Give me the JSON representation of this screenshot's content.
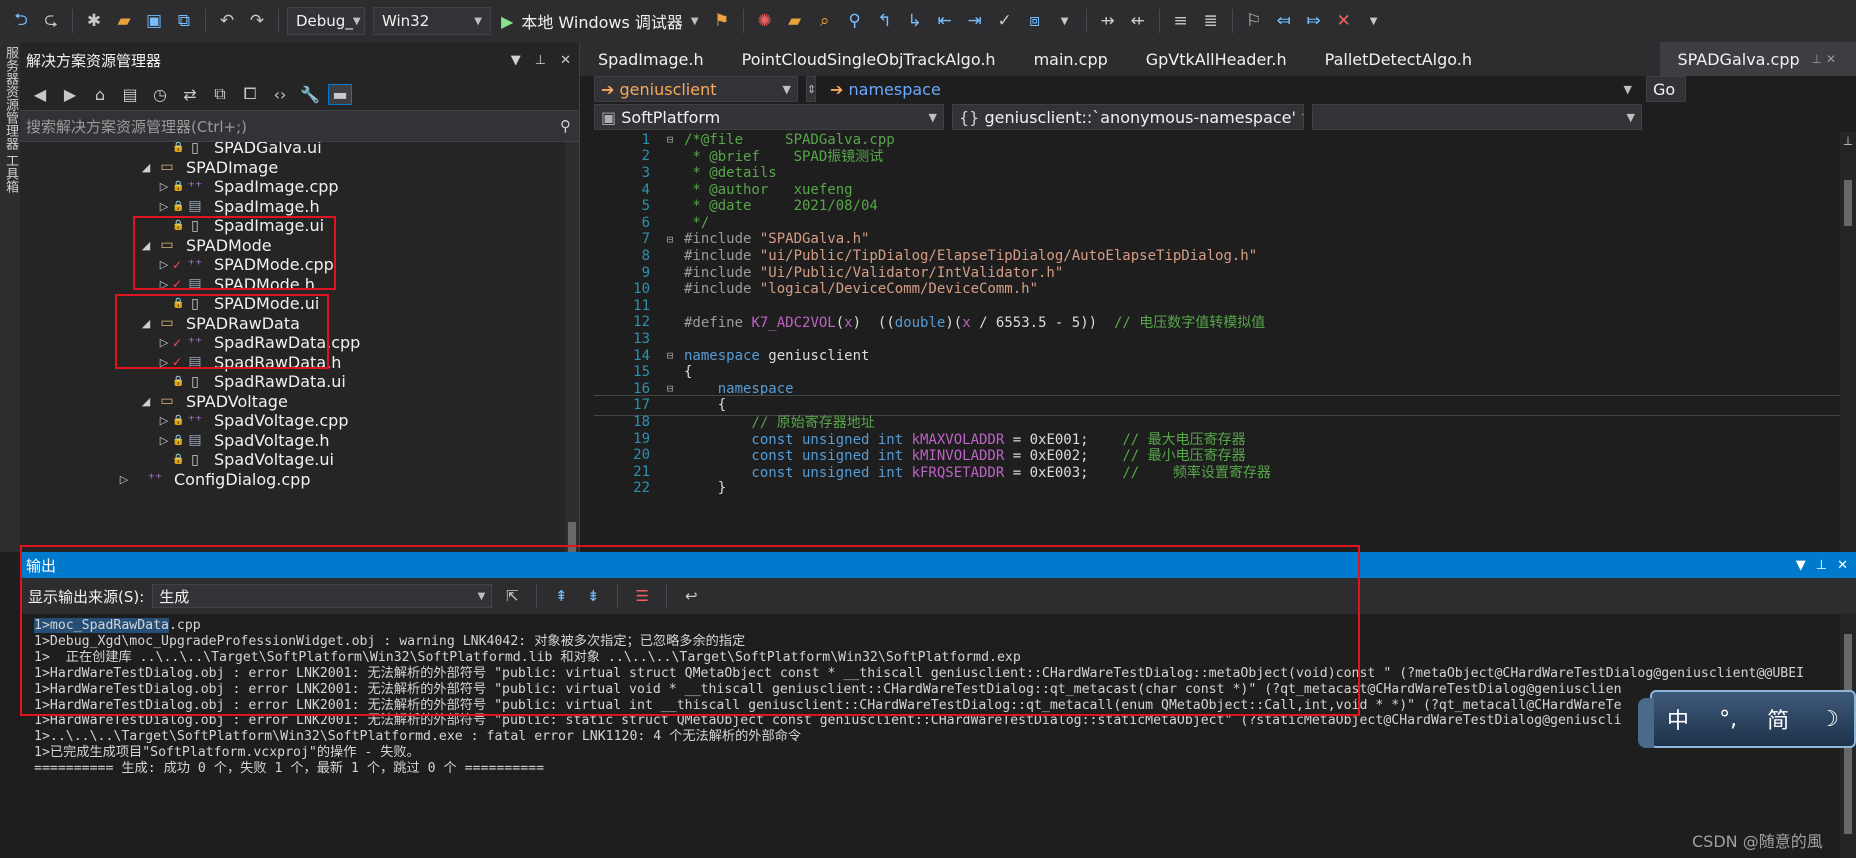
{
  "toolbar": {
    "config": "Debug_",
    "platform": "Win32",
    "run_label": "本地 Windows 调试器"
  },
  "left_strip": {
    "label": "服务器资源管理器  工具箱"
  },
  "solution": {
    "title": "解决方案资源管理器",
    "search_placeholder": "搜索解决方案资源管理器(Ctrl+;)",
    "tree": [
      {
        "text": "SPADGalva.ui",
        "kind": "ui",
        "depth": 3,
        "lock": true
      },
      {
        "text": "SPADImage",
        "kind": "folder",
        "depth": 2,
        "expanded": true
      },
      {
        "text": "SpadImage.cpp",
        "kind": "cpp",
        "depth": 3,
        "lock": true,
        "has_children": true
      },
      {
        "text": "SpadImage.h",
        "kind": "h",
        "depth": 3,
        "lock": true,
        "has_children": true
      },
      {
        "text": "SpadImage.ui",
        "kind": "ui",
        "depth": 3,
        "lock": true
      },
      {
        "text": "SPADMode",
        "kind": "folder",
        "depth": 2,
        "expanded": true
      },
      {
        "text": "SPADMode.cpp",
        "kind": "cpp",
        "depth": 3,
        "check": true,
        "has_children": true
      },
      {
        "text": "SPADMode.h",
        "kind": "h",
        "depth": 3,
        "check": true,
        "has_children": true
      },
      {
        "text": "SPADMode.ui",
        "kind": "ui",
        "depth": 3,
        "lock": true
      },
      {
        "text": "SPADRawData",
        "kind": "folder",
        "depth": 2,
        "expanded": true
      },
      {
        "text": "SpadRawData.cpp",
        "kind": "cpp",
        "depth": 3,
        "check": true,
        "has_children": true
      },
      {
        "text": "SpadRawData.h",
        "kind": "h",
        "depth": 3,
        "check": true,
        "has_children": true
      },
      {
        "text": "SpadRawData.ui",
        "kind": "ui",
        "depth": 3,
        "lock": true
      },
      {
        "text": "SPADVoltage",
        "kind": "folder",
        "depth": 2,
        "expanded": true
      },
      {
        "text": "SpadVoltage.cpp",
        "kind": "cpp",
        "depth": 3,
        "lock": true,
        "has_children": true
      },
      {
        "text": "SpadVoltage.h",
        "kind": "h",
        "depth": 3,
        "lock": true,
        "has_children": true
      },
      {
        "text": "SpadVoltage.ui",
        "kind": "ui",
        "depth": 3,
        "lock": true
      },
      {
        "text": "ConfigDialog.cpp",
        "kind": "cpp",
        "depth": 1,
        "has_children": true
      }
    ]
  },
  "editor": {
    "tabs": [
      "SpadImage.h",
      "PointCloudSingleObjTrackAlgo.h",
      "main.cpp",
      "GpVtkAllHeader.h",
      "PalletDetectAlgo.h",
      "SPADGalva.cpp"
    ],
    "active_tab": "SPADGalva.cpp",
    "nav1_left": "geniusclient",
    "nav1_mid": "namespace",
    "nav1_right": "Go",
    "nav2_left": "SoftPlatform",
    "nav2_mid": "geniusclient::`anonymous-namespace'",
    "lines": [
      {
        "n": "1",
        "fold": "⊟",
        "parts": [
          [
            "green",
            "/*@file     SPADGalva.cpp"
          ]
        ]
      },
      {
        "n": "2",
        "parts": [
          [
            "green",
            " * @brief    SPAD振镜测试"
          ]
        ]
      },
      {
        "n": "3",
        "parts": [
          [
            "green",
            " * @details"
          ]
        ]
      },
      {
        "n": "4",
        "parts": [
          [
            "green",
            " * @author   xuefeng"
          ]
        ]
      },
      {
        "n": "5",
        "parts": [
          [
            "green",
            " * @date     2021/08/04"
          ]
        ]
      },
      {
        "n": "6",
        "parts": [
          [
            "green",
            " */"
          ]
        ]
      },
      {
        "n": "7",
        "fold": "⊟",
        "parts": [
          [
            "pp",
            "#include "
          ],
          [
            "str",
            "\"SPADGalva.h\""
          ]
        ]
      },
      {
        "n": "8",
        "parts": [
          [
            "pp",
            "#include "
          ],
          [
            "str",
            "\"ui/Public/TipDialog/ElapseTipDialog/AutoElapseTipDialog.h\""
          ]
        ]
      },
      {
        "n": "9",
        "parts": [
          [
            "pp",
            "#include "
          ],
          [
            "str",
            "\"Ui/Public/Validator/IntValidator.h\""
          ]
        ]
      },
      {
        "n": "10",
        "parts": [
          [
            "pp",
            "#include "
          ],
          [
            "str",
            "\"logical/DeviceComm/DeviceComm.h\""
          ]
        ]
      },
      {
        "n": "11",
        "parts": []
      },
      {
        "n": "12",
        "parts": [
          [
            "pp",
            "#define "
          ],
          [
            "macro",
            "K7_ADC2VOL"
          ],
          [
            "ns",
            "("
          ],
          [
            "macro",
            "x"
          ],
          [
            "ns",
            ")  (("
          ],
          [
            "kw",
            "double"
          ],
          [
            "ns",
            ")("
          ],
          [
            "macro",
            "x"
          ],
          [
            "ns",
            " / 6553.5 - 5))  "
          ],
          [
            "green",
            "// 电压数字值转模拟值"
          ]
        ]
      },
      {
        "n": "13",
        "parts": []
      },
      {
        "n": "14",
        "fold": "⊟",
        "parts": [
          [
            "kw",
            "namespace"
          ],
          [
            "ns",
            " geniusclient"
          ]
        ]
      },
      {
        "n": "15",
        "parts": [
          [
            "ns",
            "{"
          ]
        ]
      },
      {
        "n": "16",
        "fold": "⊟",
        "parts": [
          [
            "kw",
            "    namespace"
          ]
        ]
      },
      {
        "n": "17",
        "cur": true,
        "parts": [
          [
            "ns",
            "    {"
          ]
        ]
      },
      {
        "n": "18",
        "parts": [
          [
            "green",
            "        // 原始寄存器地址"
          ]
        ]
      },
      {
        "n": "19",
        "parts": [
          [
            "kw",
            "        const unsigned int "
          ],
          [
            "var",
            "kMAXVOLADDR"
          ],
          [
            "ns",
            " = 0xE001;    "
          ],
          [
            "green",
            "// 最大电压寄存器"
          ]
        ]
      },
      {
        "n": "20",
        "parts": [
          [
            "kw",
            "        const unsigned int "
          ],
          [
            "var",
            "kMINVOLADDR"
          ],
          [
            "ns",
            " = 0xE002;    "
          ],
          [
            "green",
            "// 最小电压寄存器"
          ]
        ]
      },
      {
        "n": "21",
        "parts": [
          [
            "kw",
            "        const unsigned int "
          ],
          [
            "var",
            "kFRQSETADDR"
          ],
          [
            "ns",
            " = 0xE003;    "
          ],
          [
            "green",
            "//    频率设置寄存器"
          ]
        ]
      },
      {
        "n": "22",
        "parts": [
          [
            "ns",
            "    }"
          ]
        ]
      }
    ]
  },
  "output": {
    "title": "输出",
    "source_label": "显示输出来源(S):",
    "source_value": "生成",
    "lines": [
      "1>moc_SpadRawData.cpp",
      "1>Debug_Xgd\\moc_UpgradeProfessionWidget.obj : warning LNK4042: 对象被多次指定；已忽略多余的指定",
      "1>  正在创建库 ..\\..\\..\\Target\\SoftPlatform\\Win32\\SoftPlatformd.lib 和对象 ..\\..\\..\\Target\\SoftPlatform\\Win32\\SoftPlatformd.exp",
      "1>HardWareTestDialog.obj : error LNK2001: 无法解析的外部符号 \"public: virtual struct QMetaObject const * __thiscall geniusclient::CHardWareTestDialog::metaObject(void)const \" (?metaObject@CHardWareTestDialog@geniusclient@@UBEI",
      "1>HardWareTestDialog.obj : error LNK2001: 无法解析的外部符号 \"public: virtual void * __thiscall geniusclient::CHardWareTestDialog::qt_metacast(char const *)\" (?qt_metacast@CHardWareTestDialog@geniusclien",
      "1>HardWareTestDialog.obj : error LNK2001: 无法解析的外部符号 \"public: virtual int __thiscall geniusclient::CHardWareTestDialog::qt_metacall(enum QMetaObject::Call,int,void * *)\" (?qt_metacall@CHardWareTe",
      "1>HardWareTestDialog.obj : error LNK2001: 无法解析的外部符号 \"public: static struct QMetaObject const geniusclient::CHardWareTestDialog::staticMetaObject\" (?staticMetaObject@CHardWareTestDialog@geniuscli",
      "1>..\\..\\..\\Target\\SoftPlatform\\Win32\\SoftPlatformd.exe : fatal error LNK1120: 4 个无法解析的外部命令",
      "1>已完成生成项目\"SoftPlatform.vcxproj\"的操作 - 失败。",
      "========== 生成: 成功 0 个，失败 1 个，最新 1 个，跳过 0 个 =========="
    ]
  },
  "ime": {
    "chars": [
      "中",
      "°,",
      "简",
      "☽"
    ]
  },
  "watermark": "CSDN @随意的風"
}
